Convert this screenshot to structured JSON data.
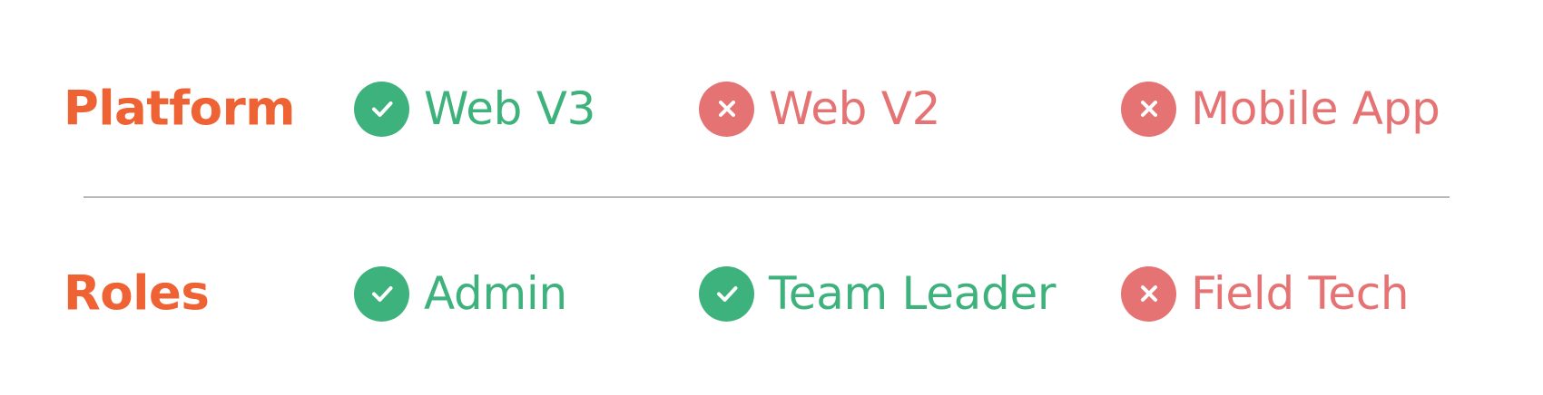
{
  "colors": {
    "heading": "#ee6234",
    "enabled": "#3eb27d",
    "disabled": "#e57374",
    "divider": "#707070"
  },
  "rows": [
    {
      "label": "Platform",
      "items": [
        {
          "text": "Web V3",
          "status": "enabled",
          "icon": "check-icon"
        },
        {
          "text": "Web V2",
          "status": "disabled",
          "icon": "x-icon"
        },
        {
          "text": "Mobile App",
          "status": "disabled",
          "icon": "x-icon"
        }
      ]
    },
    {
      "label": "Roles",
      "items": [
        {
          "text": "Admin",
          "status": "enabled",
          "icon": "check-icon"
        },
        {
          "text": "Team Leader",
          "status": "enabled",
          "icon": "check-icon"
        },
        {
          "text": "Field Tech",
          "status": "disabled",
          "icon": "x-icon"
        }
      ]
    }
  ]
}
